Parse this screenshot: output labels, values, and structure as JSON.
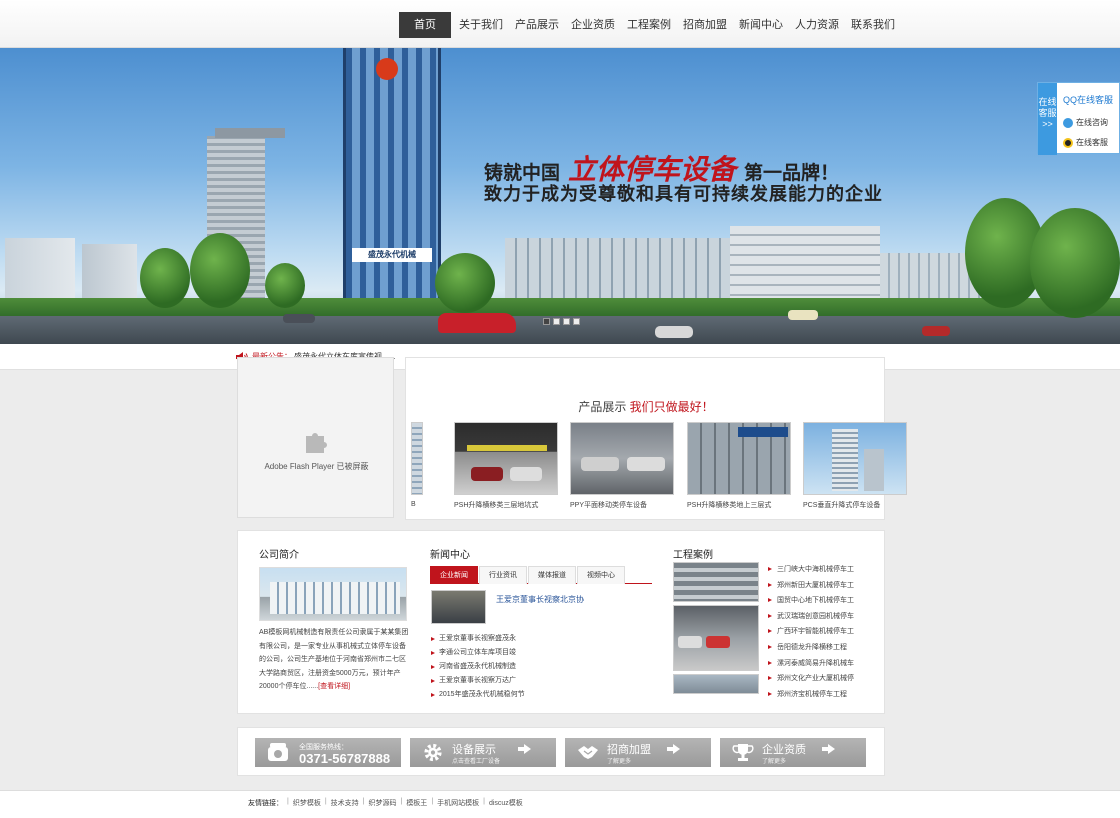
{
  "nav": {
    "items": [
      "首页",
      "关于我们",
      "产品展示",
      "企业资质",
      "工程案例",
      "招商加盟",
      "新闻中心",
      "人力资源",
      "联系我们"
    ]
  },
  "banner": {
    "slogan_prefix": "铸就中国",
    "slogan_highlight": "立体停车设备",
    "slogan_suffix": "第一品牌！",
    "slogan_line2": "致力于成为受尊敬和具有可持续发展能力的企业",
    "building_sign": "盛茂永代机械"
  },
  "qq_widget": {
    "tab": "在线客服>>",
    "title": "QQ在线客服",
    "row1": "在线咨询",
    "row2": "在线客服"
  },
  "notice": {
    "label": "最新公告：",
    "text": "盛茂永代立体车库宣传视......"
  },
  "flash": {
    "text": "Adobe Flash Player 已被屏蔽"
  },
  "products": {
    "title_prefix": "产品展示",
    "title_highlight": "我们只做最好！",
    "items": [
      {
        "caption": "PSH升降横移类三层地坑式"
      },
      {
        "caption": "PPY平面移动类停车设备"
      },
      {
        "caption": "PSH升降横移类地上三层式"
      },
      {
        "caption": "PCS垂直升降式停车设备"
      }
    ]
  },
  "intro": {
    "title": "公司简介",
    "text": "AB模板网机械制造有限责任公司隶属于某某集团有限公司，是一家专业从事机械式立体停车设备的公司，公司生产基地位于河南省郑州市二七区大学路商贸区，注册资金5000万元，预计年产20000个停车位......",
    "more": "[查看详细]"
  },
  "news": {
    "title": "新闻中心",
    "tabs": [
      "企业新闻",
      "行业资讯",
      "媒体报道",
      "视频中心"
    ],
    "headline": "王爱京董事长视察北京协",
    "items": [
      "王爱京董事长视察盛茂永",
      "李通公司立体车库项目竣",
      "河南省盛茂永代机械制造",
      "王爱京董事长视察万达广",
      "2015年盛茂永代机械稳何节"
    ]
  },
  "cases": {
    "title": "工程案例",
    "items": [
      "三门峡大中海机械停车工",
      "郑州新田大厦机械停车工",
      "国贸中心地下机械停车工",
      "武汉瑞瑞创意园机械停车",
      "广西环宇智能机械停车工",
      "岳阳德龙升降横移工程",
      "漯河泰威简易升降机械车",
      "郑州文化产业大厦机械停",
      "郑州济宝机械停车工程"
    ]
  },
  "buttons": {
    "hotline_label": "全国服务热线：",
    "hotline_number": "0371-56787888",
    "b2_title": "设备展示",
    "b2_sub": "点击查看工厂设备",
    "b3_title": "招商加盟",
    "b3_sub": "了解更多",
    "b4_title": "企业资质",
    "b4_sub": "了解更多"
  },
  "footer": {
    "label": "友情链接：",
    "links": [
      "织梦模板",
      "技术支持",
      "织梦源码",
      "模板王",
      "手机网站模板",
      "discuz模板"
    ]
  },
  "colors": {
    "accent": "#c0141c",
    "nav_active": "#3a3a3a",
    "link_blue": "#2a5599",
    "qq_blue": "#3d9ae0"
  }
}
